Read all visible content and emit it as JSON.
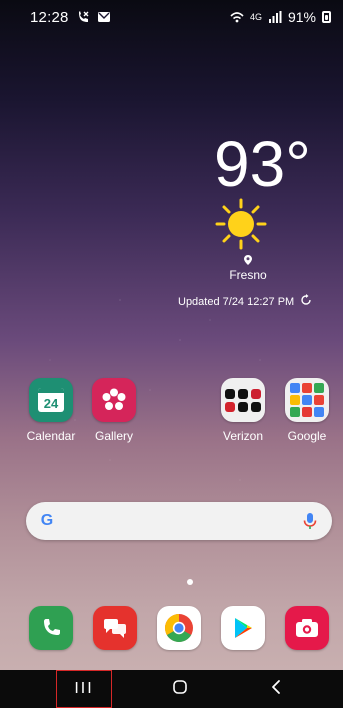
{
  "status_bar": {
    "time": "12:28",
    "battery_percent": "91%",
    "icons": [
      "missed-call-icon",
      "message-icon",
      "wifi-icon",
      "lte-icon",
      "signal-icon",
      "battery-icon"
    ]
  },
  "weather": {
    "temperature": "93°",
    "location": "Fresno",
    "updated": "Updated 7/24 12:27 PM",
    "icon": "sun-icon"
  },
  "apps": [
    {
      "label": "Calendar",
      "icon": "calendar-icon",
      "color": "#1e8f73",
      "date": "24"
    },
    {
      "label": "Gallery",
      "icon": "gallery-icon",
      "color": "#d5255a"
    },
    {
      "label": "Verizon",
      "icon": "folder-icon",
      "color": "#f0f0f0"
    },
    {
      "label": "Google",
      "icon": "folder-icon",
      "color": "#f0f0f0"
    }
  ],
  "search": {
    "logo": "G",
    "mic": "mic-icon"
  },
  "dock": [
    {
      "icon": "phone-icon",
      "color": "#2fa052"
    },
    {
      "icon": "messages-icon",
      "color": "#e5322d"
    },
    {
      "icon": "chrome-icon",
      "color": "#ffffff"
    },
    {
      "icon": "play-store-icon",
      "color": "#ffffff"
    },
    {
      "icon": "camera-icon",
      "color": "#e5194a"
    }
  ],
  "navbar": {
    "recent_label": "III",
    "home": "home-icon",
    "back": "back-icon"
  }
}
